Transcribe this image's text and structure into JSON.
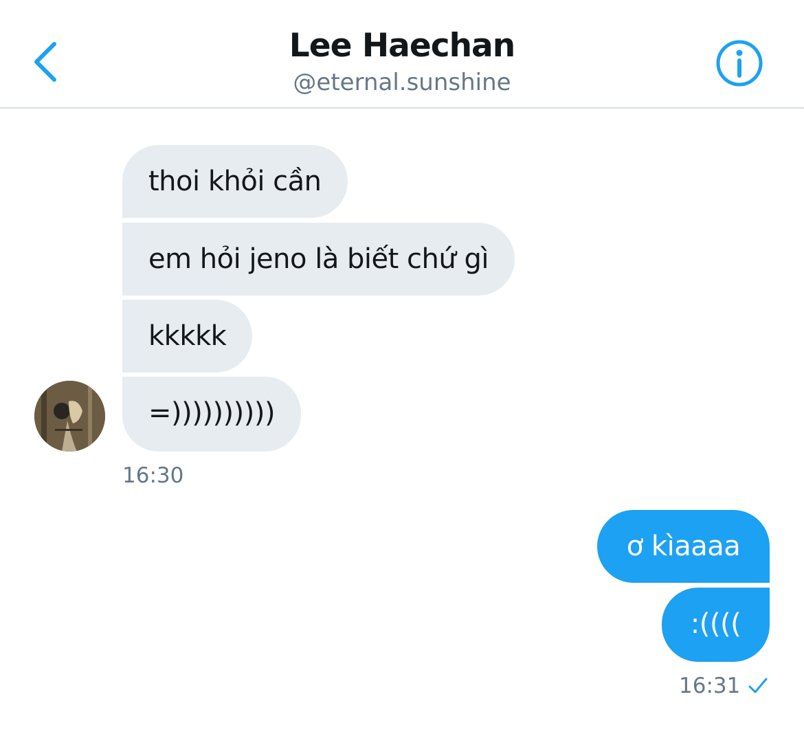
{
  "header": {
    "name": "Lee Haechan",
    "handle": "@eternal.sunshine",
    "icons": {
      "back": "chevron-left-icon",
      "info": "info-circle-icon"
    },
    "accent_color": "#1da1f2"
  },
  "incoming": {
    "messages": [
      {
        "text": "thoi khỏi cần"
      },
      {
        "text": "em hỏi jeno là biết chứ gì"
      },
      {
        "text": "kkkkk"
      },
      {
        "text": "=))))))))))"
      }
    ],
    "time": "16:30",
    "bubble_color": "#e6ecf0"
  },
  "outgoing": {
    "messages": [
      {
        "text": "ơ kìaaaa"
      },
      {
        "text": ":(((("
      }
    ],
    "time": "16:31",
    "status_icon": "check-icon",
    "bubble_color": "#1da1f2"
  }
}
